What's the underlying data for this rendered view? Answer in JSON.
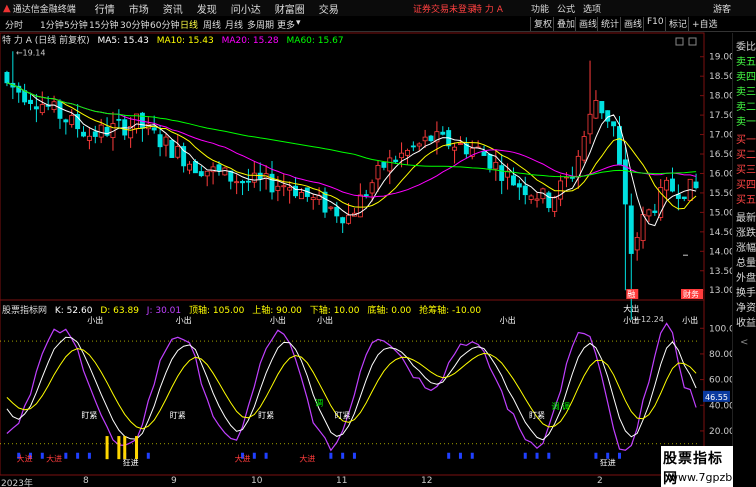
{
  "titlebar": {
    "app_name": "通达信金融终端",
    "menus": [
      "行情",
      "市场",
      "资讯",
      "发现",
      "问小达",
      "财富圈",
      "交易"
    ],
    "login_warning": "证券交易未登录",
    "stock": "特 力 A",
    "right_menus": [
      "功能",
      "公式",
      "选项"
    ],
    "guest": "游客"
  },
  "period_tabs": [
    "分时",
    "1分钟",
    "5分钟",
    "15分钟",
    "30分钟",
    "60分钟",
    "日线",
    "周线",
    "月线",
    "多周期",
    "更多"
  ],
  "active_tab": "日线",
  "right_buttons": [
    "复权",
    "叠加",
    "画线",
    "统计",
    "画线",
    "F10",
    "标记",
    "+自选"
  ],
  "main_header": {
    "stock_title": "特 力 A (日线 前复权)",
    "ma5": "MA5: 15.43",
    "ma10": "MA10: 15.43",
    "ma20": "MA20: 15.28",
    "ma60": "MA60: 15.67"
  },
  "price_axis": [
    "19.00",
    "18.50",
    "18.00",
    "17.50",
    "17.00",
    "16.50",
    "16.00",
    "15.50",
    "15.00",
    "14.50",
    "14.00",
    "13.50",
    "13.00"
  ],
  "chart_annotations": {
    "high": "19.14",
    "low": "12.24",
    "low_tag": "融",
    "right_tag": "财务"
  },
  "indicator_header": {
    "name": "股票指标网",
    "k": "K: 52.60",
    "d": "D: 63.89",
    "j": "J: 30.01",
    "top": "顶轴: 105.00",
    "upper": "上轴: 90.00",
    "lower": "下轴: 10.00",
    "bottom": "底轴: 0.00",
    "buy_line": "抢筹轴: -10.00"
  },
  "indicator_axis": [
    "100.00",
    "80.00",
    "60.00",
    "40.00",
    "20.00"
  ],
  "indicator_value_badge": "46.55",
  "indicator_labels": {
    "small_out": "小出",
    "big_out": "大出",
    "watch": "盯紧",
    "adjust": "调",
    "big_in": "大进",
    "crazy_in": "狂进"
  },
  "date_axis": [
    "2023年",
    "8",
    "9",
    "10",
    "11",
    "12",
    "2",
    "3"
  ],
  "side_panel": {
    "items": [
      "委比",
      "卖五",
      "卖四",
      "卖三",
      "卖二",
      "卖一",
      "买一",
      "买二",
      "买三",
      "买四",
      "买五",
      "最新",
      "涨跌",
      "涨幅",
      "总量",
      "外盘",
      "换手",
      "净资",
      "收益"
    ],
    "expand": "<"
  },
  "watermark": {
    "title": "股票指标网",
    "url": "www.7gpzb.com"
  },
  "colors": {
    "up": "#ff3c3c",
    "down": "#00e0e0",
    "ma5": "#ffffff",
    "ma10": "#ffff00",
    "ma20": "#ff00ff",
    "ma60": "#00ff00",
    "k_line": "#ffffff",
    "d_line": "#ffff00",
    "j_line": "#c040ff"
  }
}
